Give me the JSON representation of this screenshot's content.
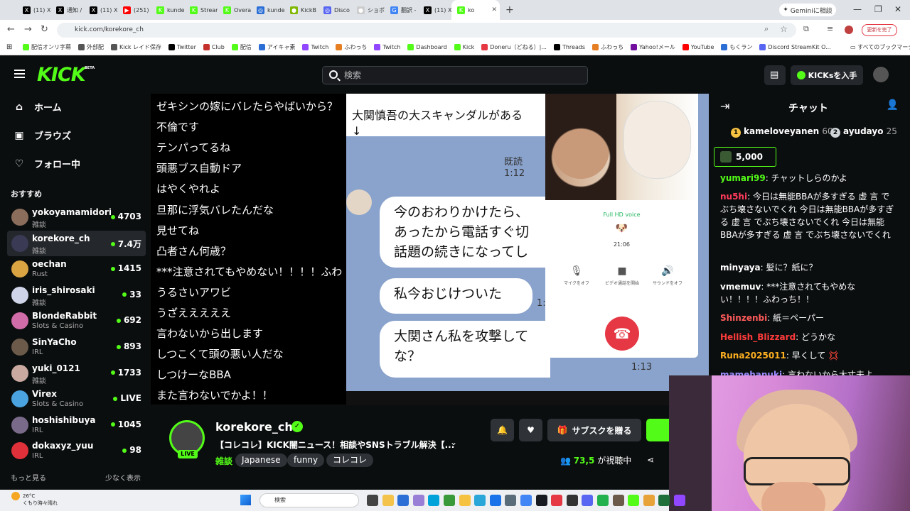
{
  "browser": {
    "tabs": [
      {
        "label": "(11) X",
        "color": "#000000",
        "glyph": "X"
      },
      {
        "label": "通知 /",
        "color": "#000000",
        "glyph": "X"
      },
      {
        "label": "(11) X",
        "color": "#000000",
        "glyph": "X"
      },
      {
        "label": "(251)",
        "color": "#ff0000",
        "glyph": "▶"
      },
      {
        "label": "kunde",
        "color": "#53fc18",
        "glyph": "K"
      },
      {
        "label": "Stream",
        "color": "#53fc18",
        "glyph": "K"
      },
      {
        "label": "Overa",
        "color": "#53fc18",
        "glyph": "K"
      },
      {
        "label": "kunde",
        "color": "#2b6fd6",
        "glyph": "◎"
      },
      {
        "label": "KickB",
        "color": "#7fb800",
        "glyph": "●"
      },
      {
        "label": "Disco",
        "color": "#5865f2",
        "glyph": "◎"
      },
      {
        "label": "ショボ",
        "color": "#cccccc",
        "glyph": "●"
      },
      {
        "label": "翻訳 -",
        "color": "#4285f4",
        "glyph": "G"
      },
      {
        "label": "(11) X",
        "color": "#000000",
        "glyph": "X"
      },
      {
        "label": "ko",
        "color": "#53fc18",
        "glyph": "K"
      }
    ],
    "new_tab": "+",
    "gemini_label": "Geminiに相談",
    "url": "kick.com/korekore_ch",
    "profile_label": "更新を完了",
    "bookmarks": [
      {
        "label": "配信オンリ字幕",
        "color": "#53fc18"
      },
      {
        "label": "外部配",
        "color": "#555555"
      },
      {
        "label": "Kick レイド保存",
        "color": "#555555"
      },
      {
        "label": "Twitter",
        "color": "#000000"
      },
      {
        "label": "Club",
        "color": "#c4302b"
      },
      {
        "label": "配信",
        "color": "#53fc18"
      },
      {
        "label": "アイキャ素",
        "color": "#2b6fd6"
      },
      {
        "label": "Twitch",
        "color": "#9146ff"
      },
      {
        "label": "ふわっち",
        "color": "#e67e22"
      },
      {
        "label": "Twitch",
        "color": "#9146ff"
      },
      {
        "label": "Dashboard",
        "color": "#53fc18"
      },
      {
        "label": "Kick",
        "color": "#53fc18"
      },
      {
        "label": "Doneru（どねる）|...",
        "color": "#e53744"
      },
      {
        "label": "Threads",
        "color": "#000000"
      },
      {
        "label": "ふわっち",
        "color": "#e67e22"
      },
      {
        "label": "Yahoo!メール",
        "color": "#720e9e"
      },
      {
        "label": "YouTube",
        "color": "#ff0000"
      },
      {
        "label": "もくラン",
        "color": "#2b6fd6"
      },
      {
        "label": "Discord StreamKit O...",
        "color": "#5865f2"
      }
    ],
    "all_bookmarks": "すべてのブックマーク"
  },
  "kick_header": {
    "logo": "KICK",
    "beta": "BETA",
    "search_placeholder": "検索",
    "get_kicks": "KICKsを入手"
  },
  "sidebar": {
    "nav": [
      {
        "label": "ホーム",
        "icon": "home-icon",
        "glyph": "⌂"
      },
      {
        "label": "ブラウズ",
        "icon": "browse-icon",
        "glyph": "▣"
      },
      {
        "label": "フォロー中",
        "icon": "heart-icon",
        "glyph": "♡"
      }
    ],
    "recommended_title": "おすすめ",
    "channels": [
      {
        "name": "yokoyamamidori",
        "category": "雑談",
        "viewers": "4703",
        "color": "#8a6d5a"
      },
      {
        "name": "korekore_ch",
        "category": "雑談",
        "viewers": "7.4万",
        "color": "#3a3a55"
      },
      {
        "name": "oechan",
        "category": "Rust",
        "viewers": "1415",
        "color": "#d9a441"
      },
      {
        "name": "iris_shirosaki",
        "category": "雑談",
        "viewers": "33",
        "color": "#cfd4e8"
      },
      {
        "name": "BlondeRabbit",
        "category": "Slots & Casino",
        "viewers": "692",
        "color": "#d06ca8"
      },
      {
        "name": "SinYaCho",
        "category": "IRL",
        "viewers": "893",
        "color": "#6b5a4a"
      },
      {
        "name": "yuki_0121",
        "category": "雑談",
        "viewers": "1733",
        "color": "#c9a9a0"
      },
      {
        "name": "Virex",
        "category": "Slots & Casino",
        "viewers": "LIVE",
        "color": "#4aa3df"
      },
      {
        "name": "hoshishibuya",
        "category": "IRL",
        "viewers": "1045",
        "color": "#7a6a8a"
      },
      {
        "name": "dokaxyz_yuu",
        "category": "IRL",
        "viewers": "98",
        "color": "#e0303a"
      }
    ],
    "show_more": "もっと見る",
    "show_less": "少なく表示"
  },
  "video": {
    "overlay_comments": [
      "ゼキシンの嫁にバレたらやばいから？",
      "不倫です",
      "テンパってるね",
      "頭悪ブス自動ドア",
      "はやくやれよ",
      "旦那に浮気バレたんだな",
      "見せてね",
      "凸者さん何歳？",
      "***注意されてもやめない！！！！ふわ",
      "うるさいアワビ",
      "うざえええええ",
      "言わないから出します",
      "しつこくて頭の悪い人だな",
      "しつけーなBBA",
      "また言わないでかよ！！"
    ],
    "line_header": "大関慎吾の大スキャンダルがある\n↓",
    "read_1": "既読\n1:12",
    "bubble_1": "今のおわりかけたら、\nあったから電話すぐ切\n話題の続きになってし",
    "bubble_2": "私今おじけついた",
    "read_2": "1:",
    "bubble_3": "大関さん私を攻撃して\nな？",
    "read_3": "1:13",
    "call": {
      "quality": "Full HD voice",
      "emoji": "🐶",
      "time": "21:06",
      "mic": "マイクをオフ",
      "video": "ビデオ通話を開始",
      "sound": "サウンドをオフ"
    }
  },
  "stream_info": {
    "channel": "korekore_ch",
    "live": "LIVE",
    "title": "【コレコレ】KICK闇ニュース！相談やSNSトラブル解決【...",
    "category": "雑談",
    "tags": [
      "Japanese",
      "funny",
      "コレコレ"
    ],
    "gift_sub": "サブスクを贈る",
    "viewers_num": "73,5",
    "viewers_label": "が視聴中"
  },
  "chat": {
    "title": "チャット",
    "top_gifters": [
      {
        "rank": "1",
        "name": "kameloveyanen",
        "value": "60",
        "color": "#f5c242"
      },
      {
        "rank": "2",
        "name": "ayudayo",
        "value": "25",
        "color": "#cfd4d8"
      }
    ],
    "gift_amount": "5,000",
    "messages": [
      {
        "user": "yumari99",
        "text": "チャットしらのかよ",
        "color": "#53fc18"
      },
      {
        "user": "nu5hi",
        "text": "今日は無能BBAが多すぎる 虚 言 でぶち壊さないでくれ 今日は無能BBAが多すぎる 虚 言 でぶち壊さないでくれ 今日は無能BBAが多すぎる 虚 言 でぶち壊さないでくれ",
        "color": "#ff3b5c"
      },
      {
        "user": "minyaya",
        "text": "髪に？紙に？",
        "color": "#ffffff"
      },
      {
        "user": "vmemuv",
        "text": "***注意されてもやめない！！！！ふわっち！！",
        "color": "#ffffff"
      },
      {
        "user": "Shinzenbi",
        "text": "紙＝ペーパー",
        "color": "#ff5a5a"
      },
      {
        "user": "Hellish_Blizzard",
        "text": "どうかな",
        "color": "#ff3b3b"
      },
      {
        "user": "Runa2025011",
        "text": "早くして 💢",
        "color": "#ffb020"
      },
      {
        "user": "mamehanuki",
        "text": "言わないから大丈夫よ",
        "color": "#9a8cff"
      }
    ]
  },
  "taskbar": {
    "weather_temp": "26°C",
    "weather_text": "くもり時々晴れ",
    "search_placeholder": "検索"
  }
}
